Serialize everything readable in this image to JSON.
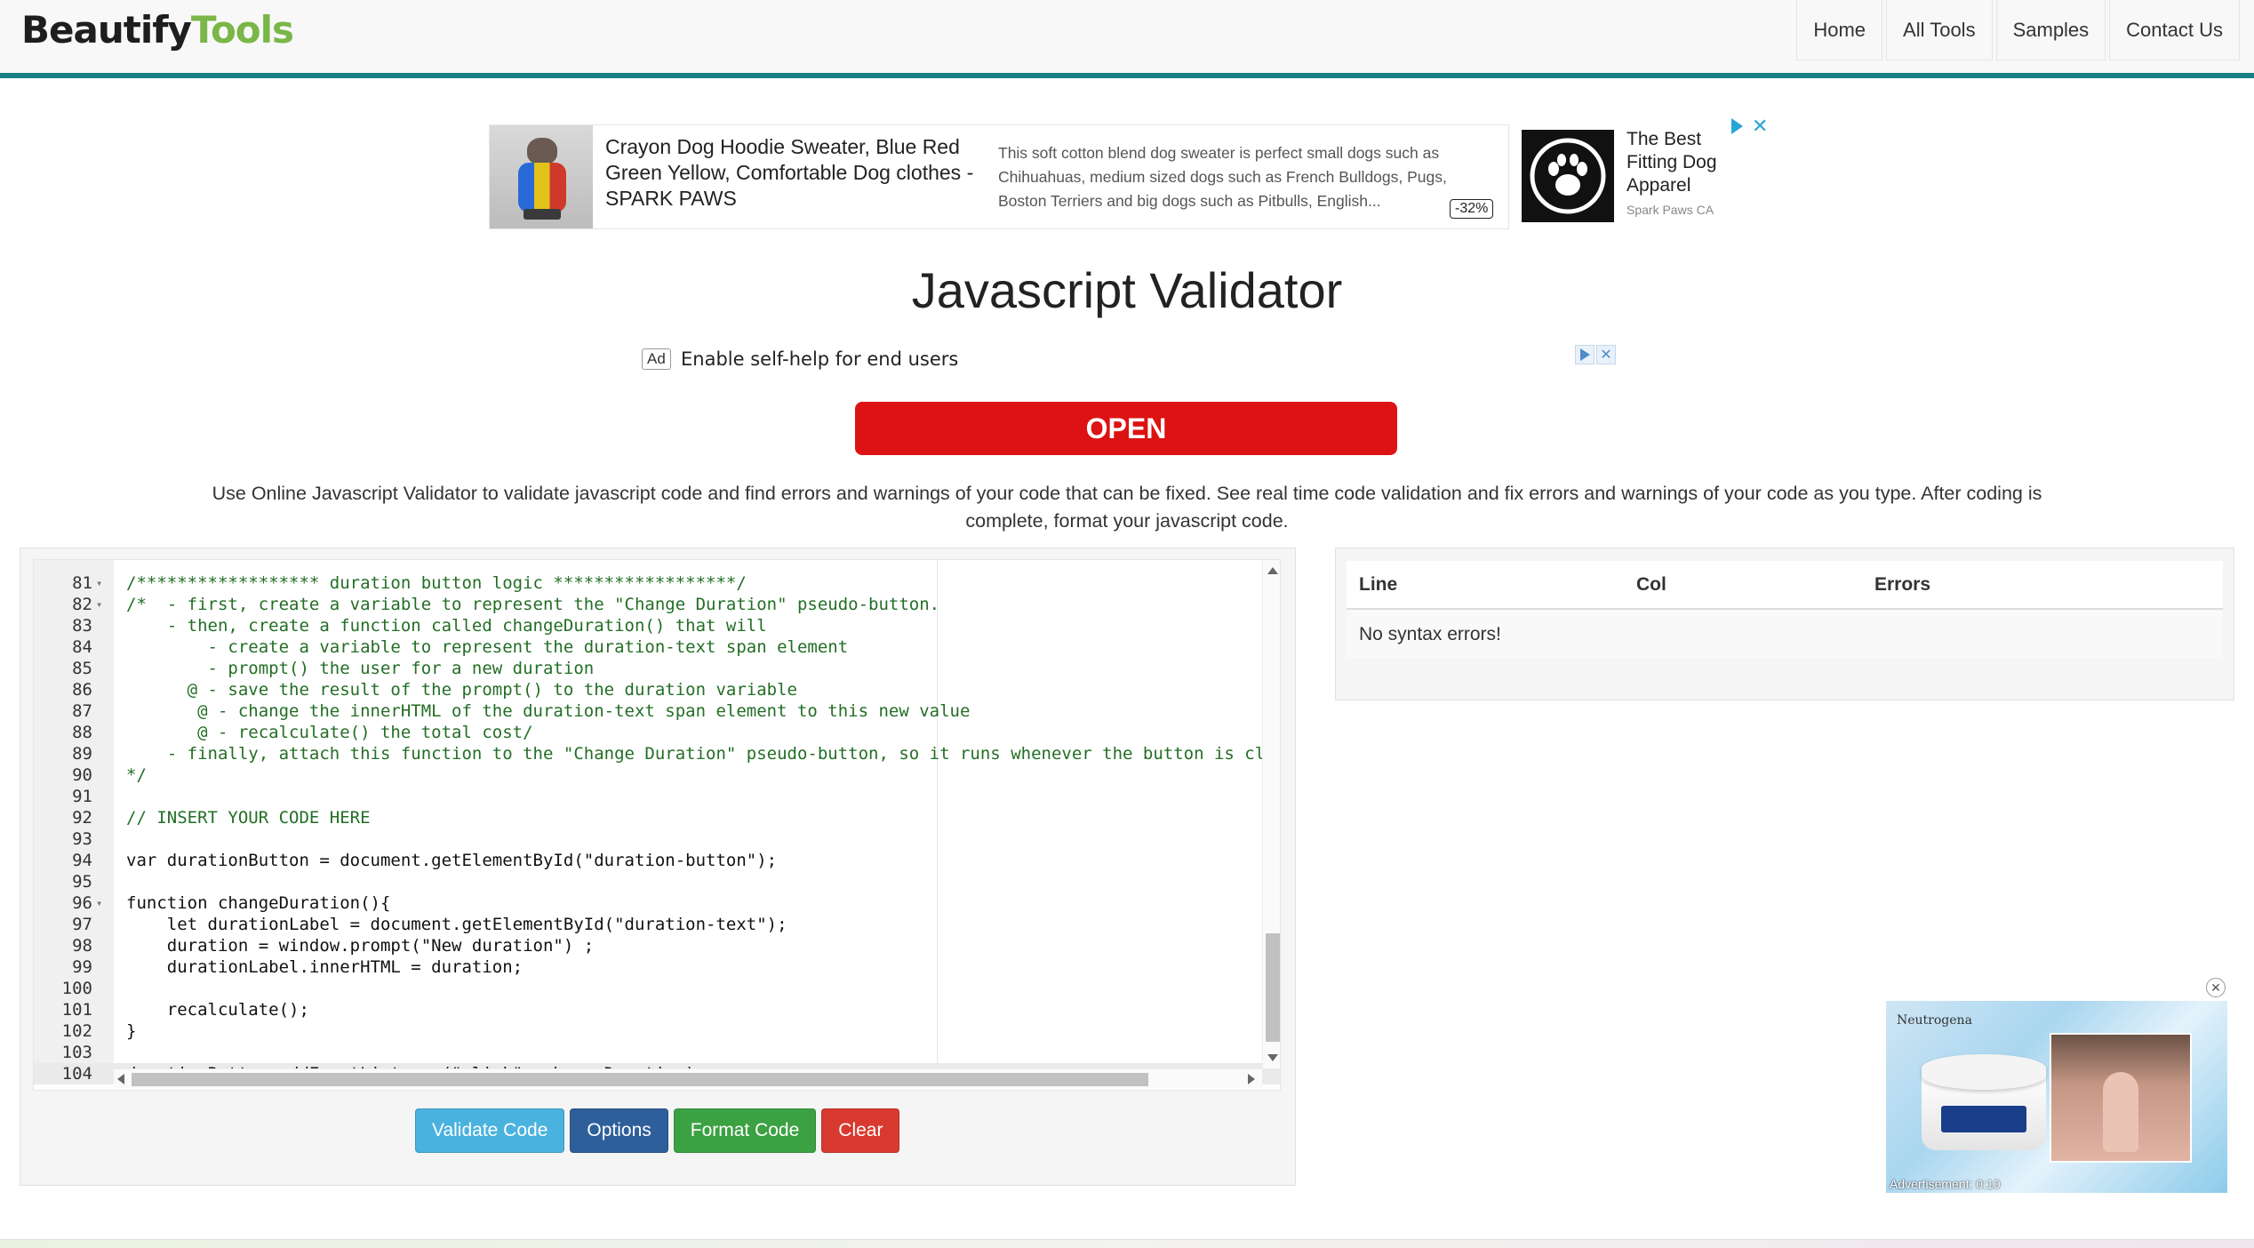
{
  "brand": {
    "part1": "Beautify",
    "part2": "Tools"
  },
  "nav": {
    "home": "Home",
    "all_tools": "All Tools",
    "samples": "Samples",
    "contact": "Contact Us"
  },
  "ad_top": {
    "headline": "Crayon Dog Hoodie Sweater, Blue Red Green Yellow, Comfortable Dog clothes - SPARK PAWS",
    "description": "This soft cotton blend dog sweater is perfect small dogs such as Chihuahuas, medium sized dogs such as French Bulldogs, Pugs, Boston Terriers and big dogs such as Pitbulls, English...",
    "discount": "-32%",
    "side_title": "The Best Fitting Dog Apparel",
    "side_sub": "Spark Paws CA"
  },
  "title": "Javascript Validator",
  "ad_mid": {
    "label": "Ad",
    "text": "Enable self-help for end users",
    "button": "OPEN"
  },
  "description": "Use Online Javascript Validator to validate javascript code and find errors and warnings of your code that can be fixed. See real time code validation and fix errors and warnings of your code as you type. After coding is complete, format your javascript code.",
  "editor": {
    "lines": [
      {
        "n": "81",
        "fold": "▾",
        "t": "/****************** duration button logic ******************/"
      },
      {
        "n": "82",
        "fold": "▾",
        "t": "/*  - first, create a variable to represent the \"Change Duration\" pseudo-button."
      },
      {
        "n": "83",
        "fold": "",
        "t": "    - then, create a function called changeDuration() that will"
      },
      {
        "n": "84",
        "fold": "",
        "t": "        - create a variable to represent the duration-text span element"
      },
      {
        "n": "85",
        "fold": "",
        "t": "        - prompt() the user for a new duration"
      },
      {
        "n": "86",
        "fold": "",
        "t": "      @ - save the result of the prompt() to the duration variable"
      },
      {
        "n": "87",
        "fold": "",
        "t": "       @ - change the innerHTML of the duration-text span element to this new value"
      },
      {
        "n": "88",
        "fold": "",
        "t": "       @ - recalculate() the total cost/"
      },
      {
        "n": "89",
        "fold": "",
        "t": "    - finally, attach this function to the \"Change Duration\" pseudo-button, so it runs whenever the button is cl"
      },
      {
        "n": "90",
        "fold": "",
        "t": "*/"
      },
      {
        "n": "91",
        "fold": "",
        "t": ""
      },
      {
        "n": "92",
        "fold": "",
        "t": "// INSERT YOUR CODE HERE"
      },
      {
        "n": "93",
        "fold": "",
        "t": ""
      },
      {
        "n": "94",
        "fold": "",
        "t": "var durationButton = document.getElementById(\"duration-button\");"
      },
      {
        "n": "95",
        "fold": "",
        "t": ""
      },
      {
        "n": "96",
        "fold": "▾",
        "t": "function changeDuration(){"
      },
      {
        "n": "97",
        "fold": "",
        "t": "    let durationLabel = document.getElementById(\"duration-text\");"
      },
      {
        "n": "98",
        "fold": "",
        "t": "    duration = window.prompt(\"New duration\") ;"
      },
      {
        "n": "99",
        "fold": "",
        "t": "    durationLabel.innerHTML = duration;"
      },
      {
        "n": "100",
        "fold": "",
        "t": ""
      },
      {
        "n": "101",
        "fold": "",
        "t": "    recalculate();"
      },
      {
        "n": "102",
        "fold": "",
        "t": "}"
      },
      {
        "n": "103",
        "fold": "",
        "t": ""
      },
      {
        "n": "104",
        "fold": "",
        "t": "durationButton.addEventListener(\"click\", changeDuration);"
      }
    ]
  },
  "buttons": {
    "validate": "Validate Code",
    "options": "Options",
    "format": "Format Code",
    "clear": "Clear"
  },
  "results": {
    "headers": [
      "Line",
      "Col",
      "Errors"
    ],
    "message": "No syntax errors!"
  },
  "video_ad": {
    "brand": "Neutrogena",
    "caption": "Advertisement: 0:10"
  },
  "colors": {
    "accent": "#1a7f84",
    "brand_green": "#7ab648",
    "open_red": "#dd1212",
    "validate": "#4ab2de",
    "options": "#2f5f9a",
    "format": "#3ca143",
    "clear": "#d83a2f"
  }
}
